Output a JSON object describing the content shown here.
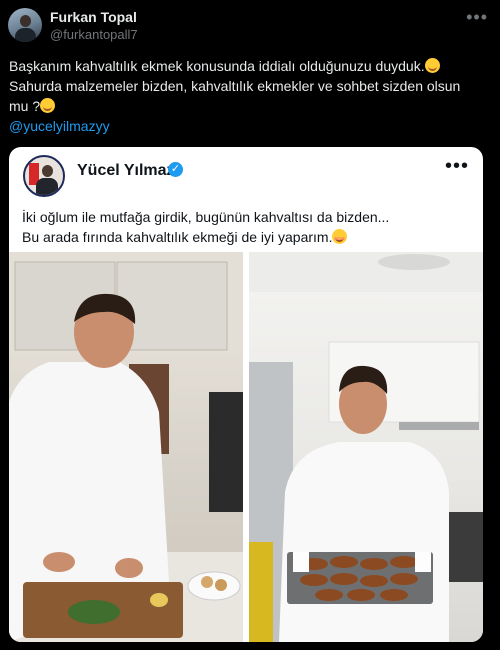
{
  "tweet": {
    "author_name": "Furkan Topal",
    "author_handle": "@furkantopall7",
    "text_line1": "Başkanım kahvaltılık ekmek konusunda iddialı olduğunuzu duyduk.",
    "text_line2": "Sahurda malzemeler bizden, kahvaltılık ekmekler ve sohbet sizden olsun",
    "text_line3": "mu ?",
    "mention": "@yucelyilmazyy",
    "menu_icon": "more-dots-icon"
  },
  "quoted": {
    "author_name": "Yücel Yılmaz",
    "verified_icon": "verified-badge-icon",
    "verified_glyph": "✓",
    "text_line1": "İki oğlum ile mutfağa girdik, bugünün kahvaltısı da bizden...",
    "text_line2": "Bu arada fırında kahvaltılık ekmeği de iyi yaparım.",
    "menu_icon": "more-dots-icon"
  },
  "colors": {
    "background": "#000000",
    "text_primary": "#e7e9ea",
    "text_secondary": "#71767b",
    "link": "#1d9bf0",
    "card_background": "#ffffff",
    "card_text": "#0f1419"
  }
}
